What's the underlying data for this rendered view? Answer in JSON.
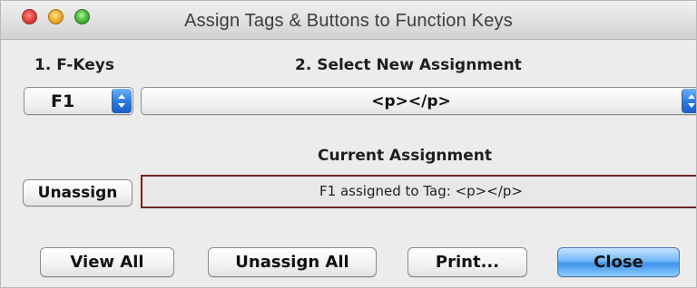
{
  "window": {
    "title": "Assign Tags & Buttons to Function Keys"
  },
  "sections": {
    "fkeys_label": "1. F-Keys",
    "new_assignment_label": "2. Select New Assignment",
    "current_assignment_label": "Current Assignment"
  },
  "controls": {
    "fkey_selected": "F1",
    "assignment_selected": "<p></p>",
    "current_assignment_text": "F1 assigned to Tag:  <p></p>"
  },
  "buttons": {
    "unassign": "Unassign",
    "view_all": "View All",
    "unassign_all": "Unassign All",
    "print": "Print...",
    "close": "Close"
  },
  "colors": {
    "primary_button": "#5aa9f4",
    "popup_arrows": "#2a78dc",
    "assignment_border": "#6f2525"
  }
}
